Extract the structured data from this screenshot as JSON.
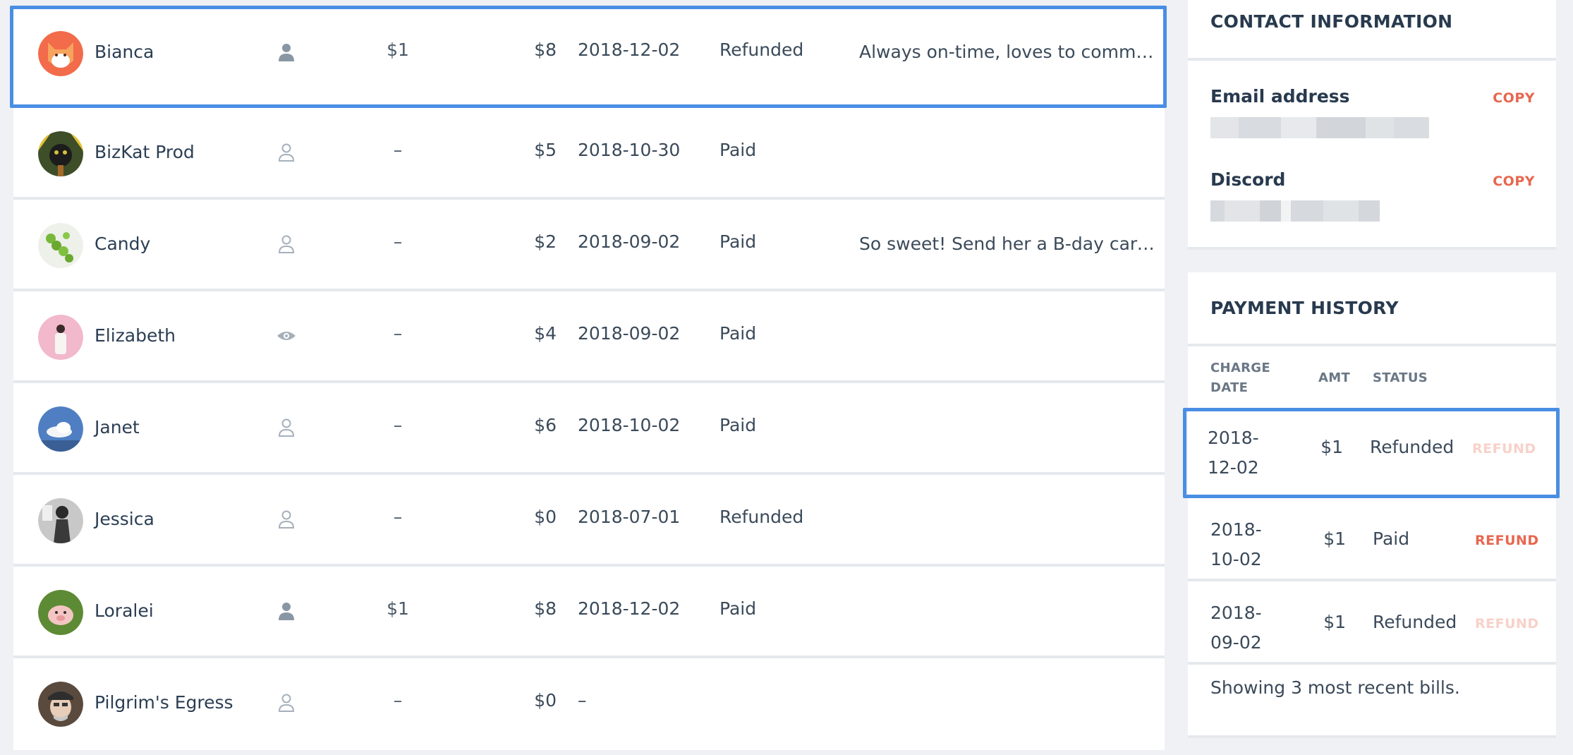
{
  "members": [
    {
      "name": "Bianca",
      "role_icon": "person-filled-icon",
      "contribution": "$1",
      "amount": "$8",
      "date": "2018-12-02",
      "status": "Refunded",
      "note": "Always on-time, loves to commen..."
    },
    {
      "name": "BizKat Prod",
      "role_icon": "person-outline-icon",
      "contribution": "–",
      "amount": "$5",
      "date": "2018-10-30",
      "status": "Paid",
      "note": ""
    },
    {
      "name": "Candy",
      "role_icon": "person-outline-icon",
      "contribution": "–",
      "amount": "$2",
      "date": "2018-09-02",
      "status": "Paid",
      "note": "So sweet! Send her a B-day card..."
    },
    {
      "name": "Elizabeth",
      "role_icon": "eye-icon",
      "contribution": "–",
      "amount": "$4",
      "date": "2018-09-02",
      "status": "Paid",
      "note": ""
    },
    {
      "name": "Janet",
      "role_icon": "person-outline-icon",
      "contribution": "–",
      "amount": "$6",
      "date": "2018-10-02",
      "status": "Paid",
      "note": ""
    },
    {
      "name": "Jessica",
      "role_icon": "person-outline-icon",
      "contribution": "–",
      "amount": "$0",
      "date": "2018-07-01",
      "status": "Refunded",
      "note": ""
    },
    {
      "name": "Loralei",
      "role_icon": "person-filled-icon",
      "contribution": "$1",
      "amount": "$8",
      "date": "2018-12-02",
      "status": "Paid",
      "note": ""
    },
    {
      "name": "Pilgrim's Egress",
      "role_icon": "person-outline-icon",
      "contribution": "–",
      "amount": "$0",
      "date": "–",
      "status": "",
      "note": ""
    }
  ],
  "contact": {
    "title": "CONTACT INFORMATION",
    "email_label": "Email address",
    "discord_label": "Discord",
    "copy_label": "COPY"
  },
  "payments": {
    "title": "PAYMENT HISTORY",
    "headers": {
      "date": "CHARGE DATE",
      "amount": "AMT",
      "status": "STATUS"
    },
    "rows": [
      {
        "date": "2018-12-02",
        "amount": "$1",
        "status": "Refunded",
        "action": "REFUND",
        "action_enabled": false
      },
      {
        "date": "2018-10-02",
        "amount": "$1",
        "status": "Paid",
        "action": "REFUND",
        "action_enabled": true
      },
      {
        "date": "2018-09-02",
        "amount": "$1",
        "status": "Refunded",
        "action": "REFUND",
        "action_enabled": false
      }
    ],
    "footer": "Showing 3 most recent bills."
  },
  "colors": {
    "accent": "#4a8ee4",
    "danger": "#e7674f",
    "danger_disabled": "#f8d1c9"
  }
}
